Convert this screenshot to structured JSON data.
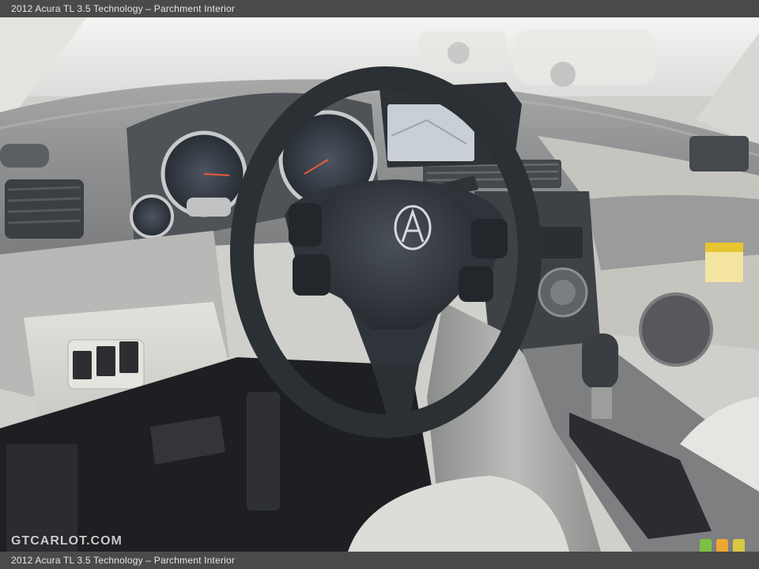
{
  "caption": {
    "top_text": "2012 Acura TL 3.5 Technology – Parchment Interior",
    "bottom_text": "2012 Acura TL 3.5 Technology – Parchment Interior"
  },
  "watermark": {
    "text": "GTCARLOT.COM"
  },
  "photo": {
    "subject": "steering wheel and dashboard",
    "colors": {
      "dash_light": "#d9d8d3",
      "dash_mid": "#8e8f8f",
      "wheel": "#2b3035",
      "console_silver": "#a8a9a6",
      "carpet": "#1e1f22",
      "badge_green": "#7cc043",
      "badge_orange": "#f0a732",
      "badge_yellow": "#d9c840"
    }
  }
}
